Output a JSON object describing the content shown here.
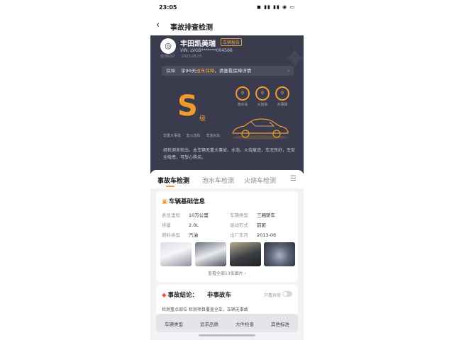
{
  "status_bar": {
    "time": "23:05",
    "icons": "◼ ▮▮ ▮▮ ◉ ▭"
  },
  "nav": {
    "back_icon": "chevron-left-icon",
    "title": "事故排查检测"
  },
  "hero": {
    "brand": "丰田凯美瑞",
    "tag": "车辆报告",
    "vin": "VIN: LVGB*******094566",
    "date_label": "检测时间",
    "date": "2023.08.05",
    "promo_label": "保障",
    "promo_text_pre": "享90天",
    "promo_text_highlight": "退车保障",
    "promo_text_post": "，请查看保障详情",
    "grade": "S",
    "grade_suffix": "级",
    "gauges": [
      {
        "value": "0",
        "label": "泡水车"
      },
      {
        "value": "0",
        "label": "火烧车"
      },
      {
        "value": "0",
        "label": "大事故"
      }
    ],
    "chips": [
      "非重大事故",
      "非火烧车",
      "非泡水车"
    ],
    "description": "经检测未检出，本车辆无重大事故、水泡、火烧痕迹，车况良好，无安全隐患，可放心购买。"
  },
  "tabs": [
    {
      "label": "事故车检测",
      "active": true
    },
    {
      "label": "泡水车检测",
      "active": false
    },
    {
      "label": "火烧车检测",
      "active": false
    }
  ],
  "basic_info": {
    "title": "车辆基础信息",
    "fields": [
      {
        "key": "表显里程",
        "value": "10万公里"
      },
      {
        "key": "车辆类型",
        "value": "三厢轿车"
      },
      {
        "key": "排量",
        "value": "2.0L"
      },
      {
        "key": "驱动形式",
        "value": "前驱"
      },
      {
        "key": "燃料类型",
        "value": "汽油"
      },
      {
        "key": "出厂年月",
        "value": "2013-06"
      }
    ],
    "all_photos": "查看全部13张图片 ›"
  },
  "accident": {
    "title": "事故结论：",
    "value": "非事故车",
    "toggle_label": "只看异常",
    "peek": "检测重点部位 检测项目覆盖全车，车辆无事故"
  },
  "bottom_bar": [
    "车辆类型",
    "追求品质",
    "大件检查",
    "其他标准"
  ]
}
